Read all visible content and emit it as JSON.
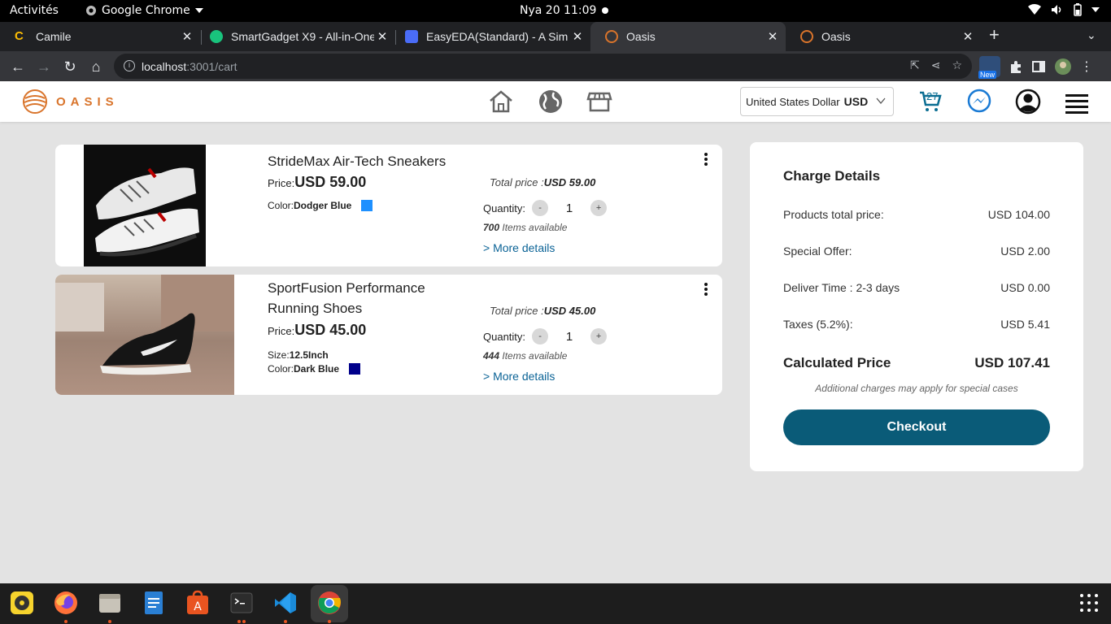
{
  "os": {
    "activities": "Activités",
    "app_name": "Google Chrome",
    "clock": "Nya 20  11:09"
  },
  "browser": {
    "tabs": [
      {
        "label": "Camile",
        "favicon_color": "#fbbc04"
      },
      {
        "label": "SmartGadget X9 - All-in-One",
        "favicon_color": "#19c37d"
      },
      {
        "label": "EasyEDA(Standard) - A Sim",
        "favicon_color": "#4a6cf7"
      },
      {
        "label": "Oasis",
        "favicon_color": "#d9742b",
        "active": true
      },
      {
        "label": "Oasis",
        "favicon_color": "#d9742b"
      }
    ],
    "url_host": "localhost",
    "url_path": ":3001/cart",
    "extension_badge": "New"
  },
  "site": {
    "logo_text": "OASIS",
    "brand_color": "#d9742b",
    "accent_color": "#0a5b78",
    "currency_name": "United States Dollar",
    "currency_code": "USD",
    "cart_count": "27"
  },
  "cart": {
    "items": [
      {
        "name": "StrideMax Air-Tech Sneakers",
        "price_label": "Price:",
        "price": "USD 59.00",
        "color_label": "Color:",
        "color_name": "Dodger Blue",
        "color_hex": "#1e90ff",
        "total_label": "Total price :",
        "total": "USD 59.00",
        "quantity_label": "Quantity:",
        "quantity": "1",
        "available_count": "700",
        "available_text": "Items available",
        "more_details": "> More details"
      },
      {
        "name_line1": "SportFusion Performance",
        "name_line2": "Running Shoes",
        "price_label": "Price:",
        "price": "USD 45.00",
        "size_label": "Size:",
        "size_value": "12.5Inch",
        "color_label": "Color:",
        "color_name": "Dark Blue",
        "color_hex": "#00008b",
        "total_label": "Total price :",
        "total": "USD 45.00",
        "quantity_label": "Quantity:",
        "quantity": "1",
        "available_count": "444",
        "available_text": "Items available",
        "more_details": "> More details"
      }
    ],
    "qty_minus": "-",
    "qty_plus": "+"
  },
  "charge": {
    "title": "Charge Details",
    "rows": [
      {
        "label": "Products total price:",
        "value": "USD 104.00"
      },
      {
        "label": "Special Offer:",
        "value": "USD 2.00"
      },
      {
        "label": "Deliver Time : 2-3 days",
        "value": "USD 0.00"
      },
      {
        "label": "Taxes (5.2%):",
        "value": "USD 5.41"
      }
    ],
    "calculated_label": "Calculated Price",
    "calculated_value": "USD 107.41",
    "note": "Additional charges may apply for special cases",
    "checkout_label": "Checkout"
  }
}
